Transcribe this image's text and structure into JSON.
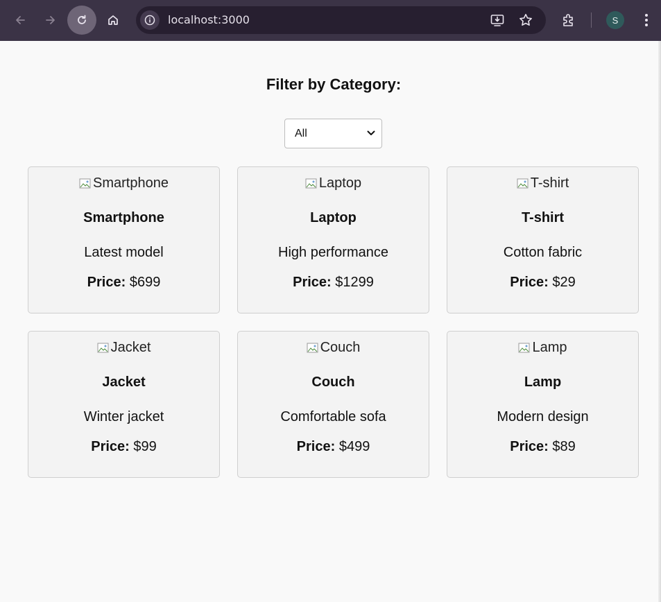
{
  "browser": {
    "url": "localhost:3000",
    "profile_initial": "S"
  },
  "page": {
    "filter_title": "Filter by Category:",
    "category_select": {
      "selected": "All"
    },
    "price_label": "Price:",
    "products": [
      {
        "image_alt": "Smartphone",
        "name": "Smartphone",
        "description": "Latest model",
        "price": "$699"
      },
      {
        "image_alt": "Laptop",
        "name": "Laptop",
        "description": "High performance",
        "price": "$1299"
      },
      {
        "image_alt": "T-shirt",
        "name": "T-shirt",
        "description": "Cotton fabric",
        "price": "$29"
      },
      {
        "image_alt": "Jacket",
        "name": "Jacket",
        "description": "Winter jacket",
        "price": "$99"
      },
      {
        "image_alt": "Couch",
        "name": "Couch",
        "description": "Comfortable sofa",
        "price": "$499"
      },
      {
        "image_alt": "Lamp",
        "name": "Lamp",
        "description": "Modern design",
        "price": "$89"
      }
    ]
  },
  "colors": {
    "toolbar": "#3b3346",
    "omnibox": "#271f30",
    "card_background": "#f3f3f3",
    "page_background": "#f9f9f9"
  }
}
